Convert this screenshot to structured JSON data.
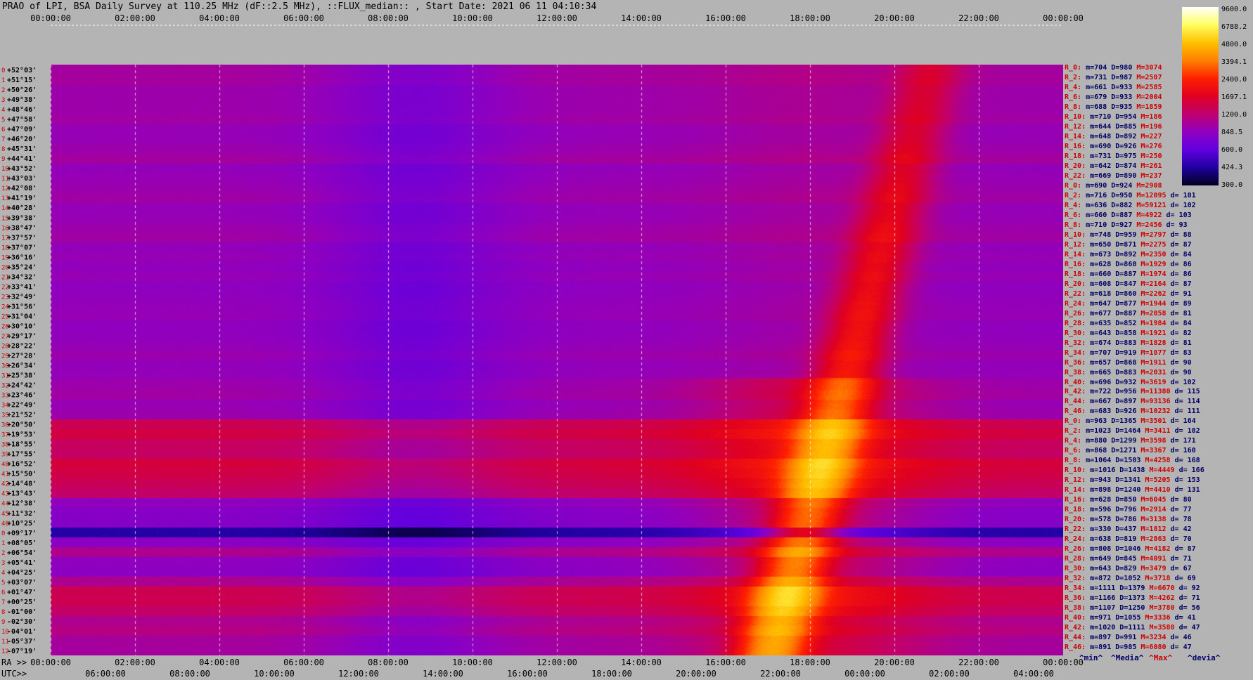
{
  "header": {
    "title": "PRAO of LPI, BSA Daily Survey at 110.25 MHz (dF::2.5 MHz), ::FLUX_median:: , Start Date: 2021 06 11 04:10:34"
  },
  "chart_data": {
    "type": "heatmap",
    "title": "PRAO of LPI, BSA Daily Survey at 110.25 MHz (dF::2.5 MHz), ::FLUX_median:: , Start Date: 2021 06 11 04:10:34",
    "x_top_ticks": [
      "00:00:00",
      "02:00:00",
      "04:00:00",
      "06:00:00",
      "08:00:00",
      "10:00:00",
      "12:00:00",
      "14:00:00",
      "16:00:00",
      "18:00:00",
      "20:00:00",
      "22:00:00",
      "00:00:00"
    ],
    "x_bottom_ra_label": "RA >>",
    "x_bottom_ra_ticks": [
      "00:00:00",
      "02:00:00",
      "04:00:00",
      "06:00:00",
      "08:00:00",
      "10:00:00",
      "12:00:00",
      "14:00:00",
      "16:00:00",
      "18:00:00",
      "20:00:00",
      "22:00:00",
      "00:00:00"
    ],
    "x_bottom_utc_label": "UTC>>",
    "x_bottom_utc_ticks": [
      "06:00:00",
      "08:00:00",
      "10:00:00",
      "12:00:00",
      "14:00:00",
      "16:00:00",
      "18:00:00",
      "20:00:00",
      "22:00:00",
      "00:00:00",
      "02:00:00",
      "04:00:00"
    ],
    "y_ticks": [
      "+52°03'",
      "+51°15'",
      "+50°26'",
      "+49°38'",
      "+48°46'",
      "+47°58'",
      "+47°09'",
      "+46°20'",
      "+45°31'",
      "+44°41'",
      "+43°52'",
      "+43°03'",
      "+42°08'",
      "+41°19'",
      "+40°28'",
      "+39°38'",
      "+38°47'",
      "+37°57'",
      "+37°07'",
      "+36°16'",
      "+35°24'",
      "+34°32'",
      "+33°41'",
      "+32°49'",
      "+31°56'",
      "+31°04'",
      "+30°10'",
      "+29°17'",
      "+28°22'",
      "+27°28'",
      "+26°34'",
      "+25°38'",
      "+24°42'",
      "+23°46'",
      "+22°49'",
      "+21°52'",
      "+20°50'",
      "+19°53'",
      "+18°55'",
      "+17°55'",
      "+16°52'",
      "+15°50'",
      "+14°48'",
      "+13°43'",
      "+12°38'",
      "+11°32'",
      "+10°25'",
      "+09°17'",
      "+08°05'",
      "+06°54'",
      "+05°41'",
      "+04°25'",
      "+03°07'",
      "+01°47'",
      "+00°25'",
      "-01°00'",
      "-02°30'",
      "-04°01'",
      "-05°37'",
      "-07°19'"
    ],
    "colorbar": {
      "ticks": [
        "9600.0",
        "6788.2",
        "4800.0",
        "3394.1",
        "2400.0",
        "1697.1",
        "1200.0",
        "848.5",
        "600.0",
        "424.3",
        "300.0"
      ],
      "colors": [
        "#ffffff",
        "#ffff60",
        "#ffc000",
        "#ff8000",
        "#ff2000",
        "#e00020",
        "#c00070",
        "#9000c0",
        "#6000e0",
        "#2000a0",
        "#000020"
      ]
    },
    "stats_legend": [
      "^min^",
      "^Media^",
      "^Max^",
      "^devia^"
    ],
    "rows": [
      {
        "r": "R_0:",
        "m": "m=704",
        "d": "D=980",
        "x": "M=3074",
        "v": ""
      },
      {
        "r": "R_2:",
        "m": "m=731",
        "d": "D=987",
        "x": "M=2507",
        "v": ""
      },
      {
        "r": "R_4:",
        "m": "m=661",
        "d": "D=933",
        "x": "M=2585",
        "v": ""
      },
      {
        "r": "R_6:",
        "m": "m=679",
        "d": "D=933",
        "x": "M=2004",
        "v": ""
      },
      {
        "r": "R_8:",
        "m": "m=688",
        "d": "D=935",
        "x": "M=1859",
        "v": ""
      },
      {
        "r": "R_10:",
        "m": "m=710",
        "d": "D=954",
        "x": "M=186",
        "v": ""
      },
      {
        "r": "R_12:",
        "m": "m=644",
        "d": "D=885",
        "x": "M=196",
        "v": ""
      },
      {
        "r": "R_14:",
        "m": "m=648",
        "d": "D=892",
        "x": "M=227",
        "v": ""
      },
      {
        "r": "R_16:",
        "m": "m=690",
        "d": "D=926",
        "x": "M=276",
        "v": ""
      },
      {
        "r": "R_18:",
        "m": "m=731",
        "d": "D=975",
        "x": "M=250",
        "v": ""
      },
      {
        "r": "R_20:",
        "m": "m=642",
        "d": "D=874",
        "x": "M=261",
        "v": ""
      },
      {
        "r": "R_22:",
        "m": "m=669",
        "d": "D=890",
        "x": "M=237",
        "v": ""
      },
      {
        "r": "R_0:",
        "m": "m=690",
        "d": "D=924",
        "x": "M=2908",
        "v": ""
      },
      {
        "r": "R_2:",
        "m": "m=716",
        "d": "D=950",
        "x": "M=12095",
        "v": "d= 101"
      },
      {
        "r": "R_4:",
        "m": "m=636",
        "d": "D=882",
        "x": "M=59121",
        "v": "d= 102"
      },
      {
        "r": "R_6:",
        "m": "m=660",
        "d": "D=887",
        "x": "M=4922",
        "v": "d= 103"
      },
      {
        "r": "R_8:",
        "m": "m=710",
        "d": "D=927",
        "x": "M=2456",
        "v": "d= 93"
      },
      {
        "r": "R_10:",
        "m": "m=748",
        "d": "D=959",
        "x": "M=2797",
        "v": "d= 88"
      },
      {
        "r": "R_12:",
        "m": "m=650",
        "d": "D=871",
        "x": "M=2275",
        "v": "d= 87"
      },
      {
        "r": "R_14:",
        "m": "m=673",
        "d": "D=892",
        "x": "M=2350",
        "v": "d= 84"
      },
      {
        "r": "R_16:",
        "m": "m=628",
        "d": "D=860",
        "x": "M=1929",
        "v": "d= 86"
      },
      {
        "r": "R_18:",
        "m": "m=660",
        "d": "D=887",
        "x": "M=1974",
        "v": "d= 86"
      },
      {
        "r": "R_20:",
        "m": "m=608",
        "d": "D=847",
        "x": "M=2164",
        "v": "d= 87"
      },
      {
        "r": "R_22:",
        "m": "m=618",
        "d": "D=860",
        "x": "M=2262",
        "v": "d= 91"
      },
      {
        "r": "R_24:",
        "m": "m=647",
        "d": "D=877",
        "x": "M=1944",
        "v": "d= 89"
      },
      {
        "r": "R_26:",
        "m": "m=677",
        "d": "D=887",
        "x": "M=2058",
        "v": "d= 81"
      },
      {
        "r": "R_28:",
        "m": "m=635",
        "d": "D=852",
        "x": "M=1984",
        "v": "d= 84"
      },
      {
        "r": "R_30:",
        "m": "m=643",
        "d": "D=858",
        "x": "M=1921",
        "v": "d= 82"
      },
      {
        "r": "R_32:",
        "m": "m=674",
        "d": "D=883",
        "x": "M=1828",
        "v": "d= 81"
      },
      {
        "r": "R_34:",
        "m": "m=707",
        "d": "D=919",
        "x": "M=1877",
        "v": "d= 83"
      },
      {
        "r": "R_36:",
        "m": "m=657",
        "d": "D=868",
        "x": "M=1911",
        "v": "d= 90"
      },
      {
        "r": "R_38:",
        "m": "m=665",
        "d": "D=883",
        "x": "M=2031",
        "v": "d= 90"
      },
      {
        "r": "R_40:",
        "m": "m=696",
        "d": "D=932",
        "x": "M=3619",
        "v": "d= 102"
      },
      {
        "r": "R_42:",
        "m": "m=722",
        "d": "D=956",
        "x": "M=11380",
        "v": "d= 115"
      },
      {
        "r": "R_44:",
        "m": "m=667",
        "d": "D=897",
        "x": "M=93136",
        "v": "d= 114"
      },
      {
        "r": "R_46:",
        "m": "m=683",
        "d": "D=926",
        "x": "M=10232",
        "v": "d= 111"
      },
      {
        "r": "R_0:",
        "m": "m=963",
        "d": "D=1365",
        "x": "M=3501",
        "v": "d= 164"
      },
      {
        "r": "R_2:",
        "m": "m=1023",
        "d": "D=1464",
        "x": "M=3411",
        "v": "d= 182"
      },
      {
        "r": "R_4:",
        "m": "m=880",
        "d": "D=1299",
        "x": "M=3598",
        "v": "d= 171"
      },
      {
        "r": "R_6:",
        "m": "m=868",
        "d": "D=1271",
        "x": "M=3367",
        "v": "d= 160"
      },
      {
        "r": "R_8:",
        "m": "m=1064",
        "d": "D=1503",
        "x": "M=4258",
        "v": "d= 168"
      },
      {
        "r": "R_10:",
        "m": "m=1016",
        "d": "D=1438",
        "x": "M=4449",
        "v": "d= 166"
      },
      {
        "r": "R_12:",
        "m": "m=943",
        "d": "D=1341",
        "x": "M=5205",
        "v": "d= 153"
      },
      {
        "r": "R_14:",
        "m": "m=898",
        "d": "D=1240",
        "x": "M=4410",
        "v": "d= 131"
      },
      {
        "r": "R_16:",
        "m": "m=628",
        "d": "D=850",
        "x": "M=6045",
        "v": "d= 80"
      },
      {
        "r": "R_18:",
        "m": "m=596",
        "d": "D=796",
        "x": "M=2914",
        "v": "d= 77"
      },
      {
        "r": "R_20:",
        "m": "m=578",
        "d": "D=786",
        "x": "M=3138",
        "v": "d= 78"
      },
      {
        "r": "R_22:",
        "m": "m=330",
        "d": "D=437",
        "x": "M=1812",
        "v": "d= 42"
      },
      {
        "r": "R_24:",
        "m": "m=638",
        "d": "D=819",
        "x": "M=2863",
        "v": "d= 70"
      },
      {
        "r": "R_26:",
        "m": "m=808",
        "d": "D=1046",
        "x": "M=4182",
        "v": "d= 87"
      },
      {
        "r": "R_28:",
        "m": "m=649",
        "d": "D=845",
        "x": "M=4091",
        "v": "d= 71"
      },
      {
        "r": "R_30:",
        "m": "m=643",
        "d": "D=829",
        "x": "M=3479",
        "v": "d= 67"
      },
      {
        "r": "R_32:",
        "m": "m=872",
        "d": "D=1052",
        "x": "M=3718",
        "v": "d= 69"
      },
      {
        "r": "R_34:",
        "m": "m=1111",
        "d": "D=1379",
        "x": "M=6670",
        "v": "d= 92"
      },
      {
        "r": "R_36:",
        "m": "m=1166",
        "d": "D=1373",
        "x": "M=4262",
        "v": "d= 71"
      },
      {
        "r": "R_38:",
        "m": "m=1107",
        "d": "D=1250",
        "x": "M=3780",
        "v": "d= 56"
      },
      {
        "r": "R_40:",
        "m": "m=971",
        "d": "D=1055",
        "x": "M=3336",
        "v": "d= 41"
      },
      {
        "r": "R_42:",
        "m": "m=1020",
        "d": "D=1111",
        "x": "M=3580",
        "v": "d= 47"
      },
      {
        "r": "R_44:",
        "m": "m=897",
        "d": "D=991",
        "x": "M=3234",
        "v": "d= 46"
      },
      {
        "r": "R_46:",
        "m": "m=891",
        "d": "D=985",
        "x": "M=6080",
        "v": "d= 47"
      }
    ]
  }
}
